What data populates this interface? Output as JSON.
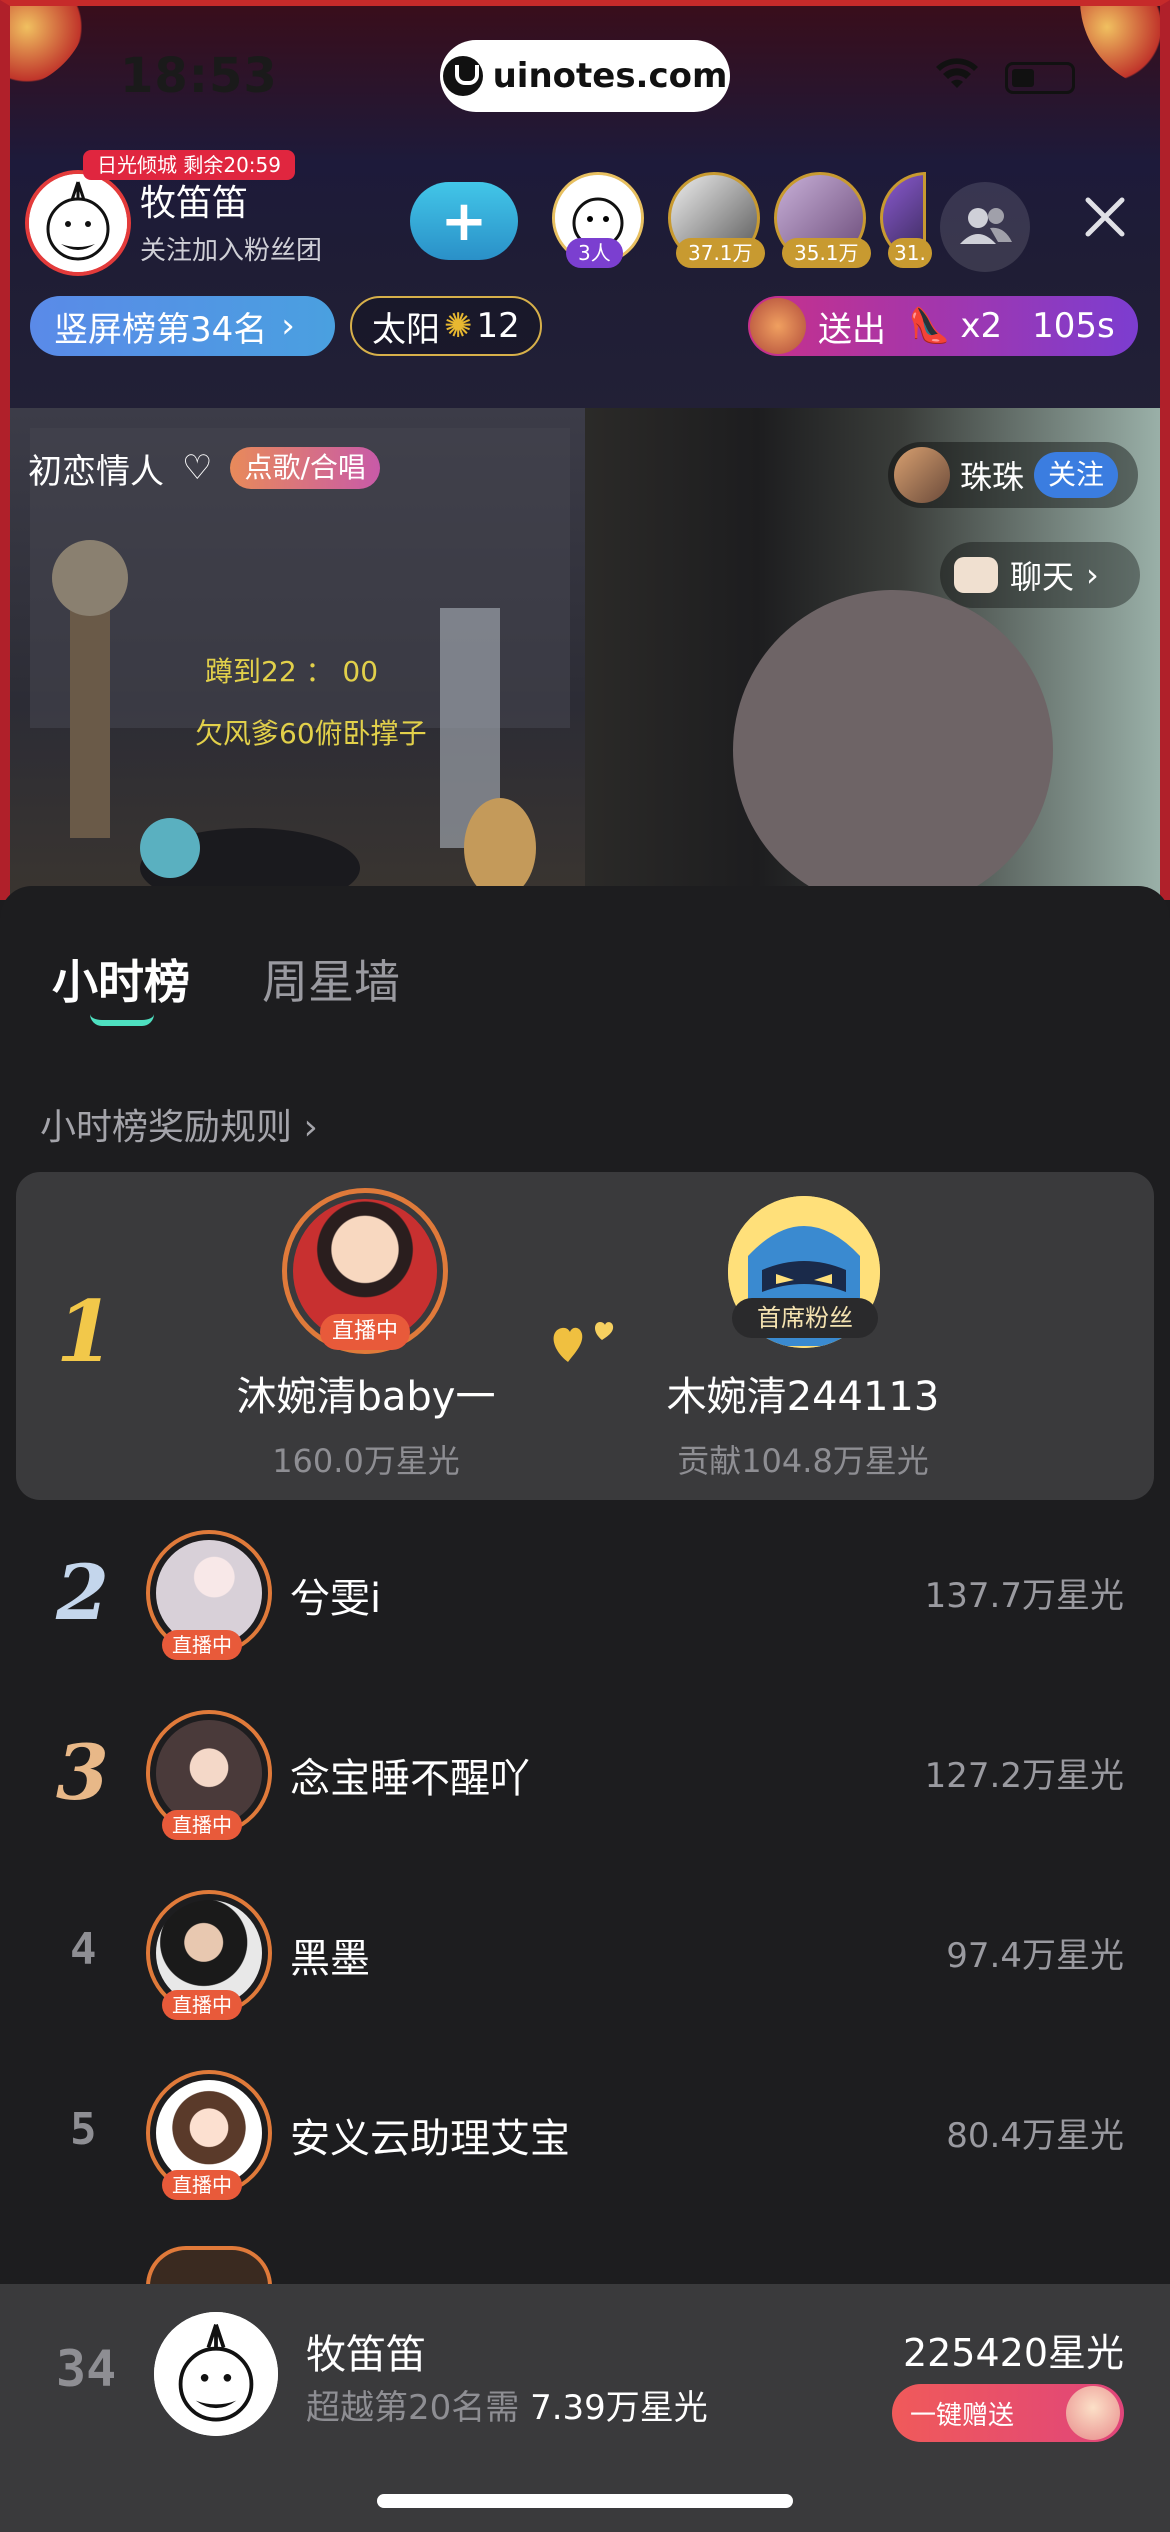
{
  "status_bar": {
    "time": "18:53",
    "url": "uinotes.com"
  },
  "anchor": {
    "rank_tag": "日光倾城 剩余20:59",
    "name": "牧笛笛",
    "subtitle": "关注加入粉丝团",
    "follow_label": "+"
  },
  "viewers": [
    {
      "badge": "3人",
      "badge_color": "#7b3fd0"
    },
    {
      "badge": "37.1万",
      "badge_color": "#c89a30"
    },
    {
      "badge": "35.1万",
      "badge_color": "#c89a30"
    },
    {
      "badge": "31.",
      "badge_color": "#c89a30"
    }
  ],
  "pills": {
    "rank": "竖屏榜第34名",
    "sun": "太阳",
    "sun_count": "12",
    "gift_send": "送出",
    "gift_count": "x2",
    "gift_timer": "105s"
  },
  "video": {
    "song_title": "初恋情人",
    "song_tag": "点歌/合唱",
    "overlay_line1": "蹲到22 ： 00",
    "overlay_line2": "欠风爹60俯卧撑子",
    "peer_name": "珠珠",
    "peer_follow": "关注",
    "chat_label": "聊天"
  },
  "tabs": [
    {
      "label": "小时榜",
      "active": true
    },
    {
      "label": "周星墙",
      "active": false
    }
  ],
  "rules_link": "小时榜奖励规则",
  "top1": {
    "rank": "1",
    "anchor_name": "沐婉清baby一",
    "anchor_points": "160.0万星光",
    "anchor_badge": "直播中",
    "fan_name": "木婉清244113",
    "fan_points": "贡献104.8万星光",
    "fan_badge": "首席粉丝"
  },
  "rows": [
    {
      "rank": "2",
      "name": "兮雯i",
      "value": "137.7万星光",
      "badge": "直播中",
      "rank_color": "#c4d6ec"
    },
    {
      "rank": "3",
      "name": "念宝睡不醒吖",
      "value": "127.2万星光",
      "badge": "直播中",
      "rank_color": "#e8b888"
    },
    {
      "rank": "4",
      "name": "黑墨",
      "value": "97.4万星光",
      "badge": "直播中"
    },
    {
      "rank": "5",
      "name": "安义云助理艾宝",
      "value": "80.4万星光",
      "badge": "直播中"
    }
  ],
  "me": {
    "rank": "34",
    "name": "牧笛笛",
    "sub_prefix": "超越第20名需",
    "sub_value": "7.39万星光",
    "points": "225420星光",
    "gift_button": "一键赠送"
  },
  "colors": {
    "accent_teal": "#4ee0c0",
    "live_ring": "#e07a3a",
    "rank1_gold": "#f2c84a"
  }
}
